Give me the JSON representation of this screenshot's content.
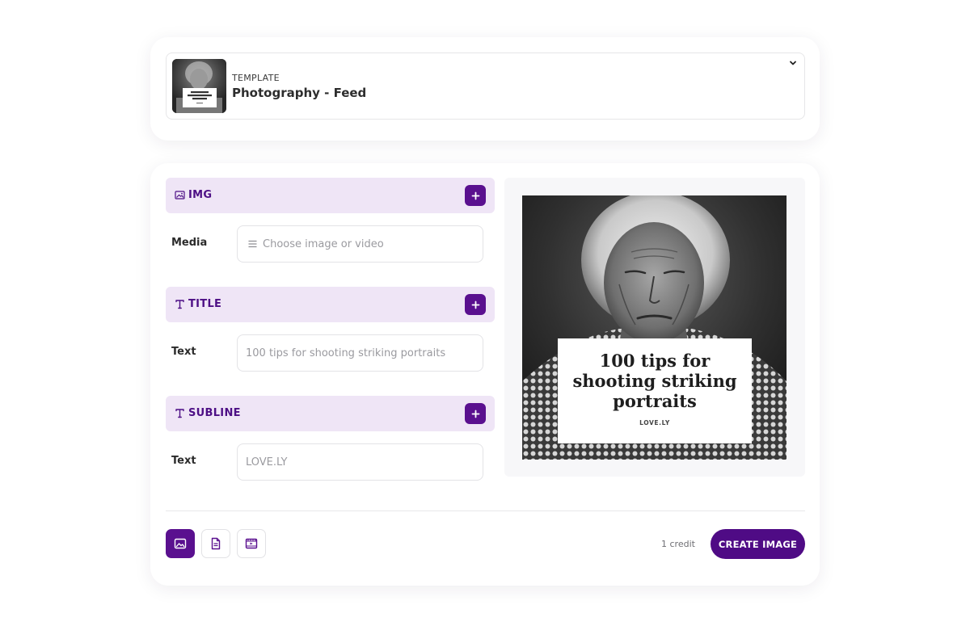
{
  "template": {
    "kicker": "TEMPLATE",
    "name": "Photography - Feed",
    "thumbnail_title": "100 tips for shooting striking portraits"
  },
  "sections": [
    {
      "icon": "image-icon",
      "label": "IMG",
      "field_label": "Media",
      "field_placeholder": "Choose image or video"
    },
    {
      "icon": "text-icon",
      "label": "TITLE",
      "field_label": "Text",
      "field_placeholder": "100 tips for shooting striking portraits"
    },
    {
      "icon": "text-icon",
      "label": "SUBLINE",
      "field_label": "Text",
      "field_placeholder": "LOVE.LY"
    }
  ],
  "preview": {
    "title": "100 tips for shooting striking portraits",
    "title_line1": "100 tips for",
    "title_line2": "shooting striking",
    "title_line3": "portraits",
    "subline": "LOVE.LY"
  },
  "footer": {
    "modes": [
      "image-icon",
      "document-icon",
      "video-icon"
    ],
    "active_mode": "image-icon",
    "credit": "1 credit",
    "create_label": "CREATE IMAGE"
  },
  "colors": {
    "accent": "#5a108f",
    "section_bg": "#efe5f6",
    "section_label": "#4d0f85"
  }
}
